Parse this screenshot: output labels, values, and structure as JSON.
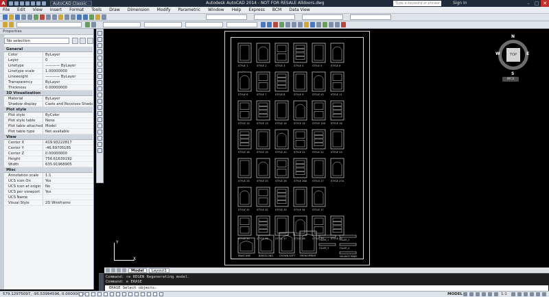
{
  "window": {
    "title": "Autodesk AutoCAD 2014 - NOT FOR RESALE   Alldoors.dwg",
    "workspace": "AutoCAD Classic",
    "search_placeholder": "Type a keyword or phrase",
    "sign_in": "Sign In"
  },
  "menu": [
    "File",
    "Edit",
    "View",
    "Insert",
    "Format",
    "Tools",
    "Draw",
    "Dimension",
    "Modify",
    "Parametric",
    "Window",
    "Help",
    "Express",
    "BCM",
    "Data View"
  ],
  "properties": {
    "title": "Properties",
    "selection": "No selection",
    "sections": [
      {
        "name": "General",
        "rows": [
          {
            "key": "Color",
            "value": "ByLayer"
          },
          {
            "key": "Layer",
            "value": "0"
          },
          {
            "key": "Linetype",
            "value": "———— ByLayer"
          },
          {
            "key": "Linetype scale",
            "value": "1.00000000"
          },
          {
            "key": "Lineweight",
            "value": "———— ByLayer"
          },
          {
            "key": "Transparency",
            "value": "ByLayer"
          },
          {
            "key": "Thickness",
            "value": "0.00000000"
          }
        ]
      },
      {
        "name": "3D Visualization",
        "rows": [
          {
            "key": "Material",
            "value": "ByLayer"
          },
          {
            "key": "Shadow display",
            "value": "Casts and Receives Shadows"
          }
        ]
      },
      {
        "name": "Plot style",
        "rows": [
          {
            "key": "Plot style",
            "value": "ByColor"
          },
          {
            "key": "Plot style table",
            "value": "None"
          },
          {
            "key": "Plot table attached to",
            "value": "Model"
          },
          {
            "key": "Plot table type",
            "value": "Not available"
          }
        ]
      },
      {
        "name": "View",
        "rows": [
          {
            "key": "Center X",
            "value": "419.93222817"
          },
          {
            "key": "Center Y",
            "value": "-46.69705185"
          },
          {
            "key": "Center Z",
            "value": "0.00000000"
          },
          {
            "key": "Height",
            "value": "756.61639192"
          },
          {
            "key": "Width",
            "value": "635.91968905"
          }
        ]
      },
      {
        "name": "Misc",
        "rows": [
          {
            "key": "Annotation scale",
            "value": "1:1"
          },
          {
            "key": "UCS icon On",
            "value": "Yes"
          },
          {
            "key": "UCS icon at origin",
            "value": "No"
          },
          {
            "key": "UCS per viewport",
            "value": "Yes"
          },
          {
            "key": "UCS Name",
            "value": ""
          },
          {
            "key": "Visual Style",
            "value": "2D Wireframe"
          }
        ]
      }
    ]
  },
  "drawing": {
    "styles_row1": [
      "STYLE 1",
      "STYLE 2",
      "STYLE 3",
      "STYLE 4",
      "STYLE 5",
      "STYLE 6"
    ],
    "styles_row2": [
      "STYLE 6",
      "STYLE 7",
      "STYLE 8",
      "STYLE 9",
      "STYLE 10",
      "STYLE 11"
    ],
    "styles_row3": [
      "STYLE 12",
      "STYLE 13",
      "STYLE 14",
      "STYLE 15",
      "STYLE 15A",
      "STYLE 16"
    ],
    "styles_row4": [
      "STYLE 18",
      "STYLE 19",
      "STYLE 20",
      "STYLE 21",
      "STYLE 22",
      "STYLE 23"
    ],
    "styles_row5": [
      "STYLE 24",
      "STYLE 25",
      "STYLE 26",
      "STYLE 26A",
      "STYLE 27",
      "STYLE 27A"
    ],
    "styles_row6": [
      "STYLE 31",
      "STYLE 32",
      "STYLE 33",
      "STYLE 34",
      "STYLE 17"
    ],
    "styles_row7": [
      "STYLE 35",
      "STYLE 36",
      "STYLE 37",
      "STYLE 38",
      "STYLE 39",
      "STYLE 40"
    ],
    "bottom_labels": [
      "MAKE-AME",
      "BARCELONA",
      "CROWN-SOFT",
      "FRENCHPRINT",
      "FILLER_1",
      "FILLER_2",
      "FILLER_3",
      "FILLER_4",
      "VALANCE PANEL"
    ]
  },
  "viewcube": {
    "top": "TOP",
    "n": "N",
    "s": "S",
    "e": "E",
    "w": "W",
    "wcs": "WCS"
  },
  "ucs": {
    "x": "X",
    "y": "Y"
  },
  "tabs": [
    "Model",
    "Layout1"
  ],
  "command": {
    "line1": "Command: re REGEN Regenerating model.",
    "line2": "Command: e ERASE",
    "prompt": "ERASE Select objects:"
  },
  "status": {
    "coords": "579.12975097, -95.53994596, 0.00000000",
    "model": "MODEL",
    "scale": "1:1"
  }
}
